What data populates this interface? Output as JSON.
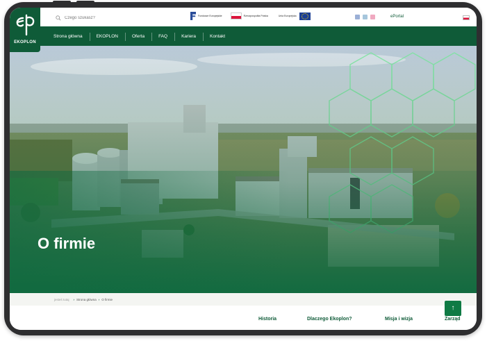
{
  "brand": {
    "name": "EKOPLON"
  },
  "search": {
    "placeholder": "Czego szukasz?"
  },
  "header_logos": [
    {
      "text": "Fundusze Europejskie"
    },
    {
      "text": "Rzeczpospolita Polska"
    },
    {
      "text": "Unia Europejska"
    }
  ],
  "social_icons": [
    {
      "icon": "facebook-icon",
      "color": "#3b5998"
    },
    {
      "icon": "linkedin-icon",
      "color": "#0e76a8"
    },
    {
      "icon": "instagram-icon",
      "color": "#e1306c"
    }
  ],
  "eportal": "ePortal",
  "nav": {
    "items": [
      {
        "label": "Strona główna"
      },
      {
        "label": "EKOPLON"
      },
      {
        "label": "Oferta"
      },
      {
        "label": "FAQ"
      },
      {
        "label": "Kariera"
      },
      {
        "label": "Kontakt"
      }
    ]
  },
  "hero": {
    "title": "O firmie"
  },
  "breadcrumb": {
    "lead": "jesteś tutaj",
    "items": [
      "Strona główna",
      "O firmie"
    ]
  },
  "subnav": {
    "items": [
      "Historia",
      "Dlaczego Ekoplon?",
      "Misja i wizja",
      "Zarząd"
    ]
  },
  "back_to_top": "↑",
  "colors": {
    "brand_green": "#0f5b38",
    "accent_green": "#0f7a44"
  }
}
